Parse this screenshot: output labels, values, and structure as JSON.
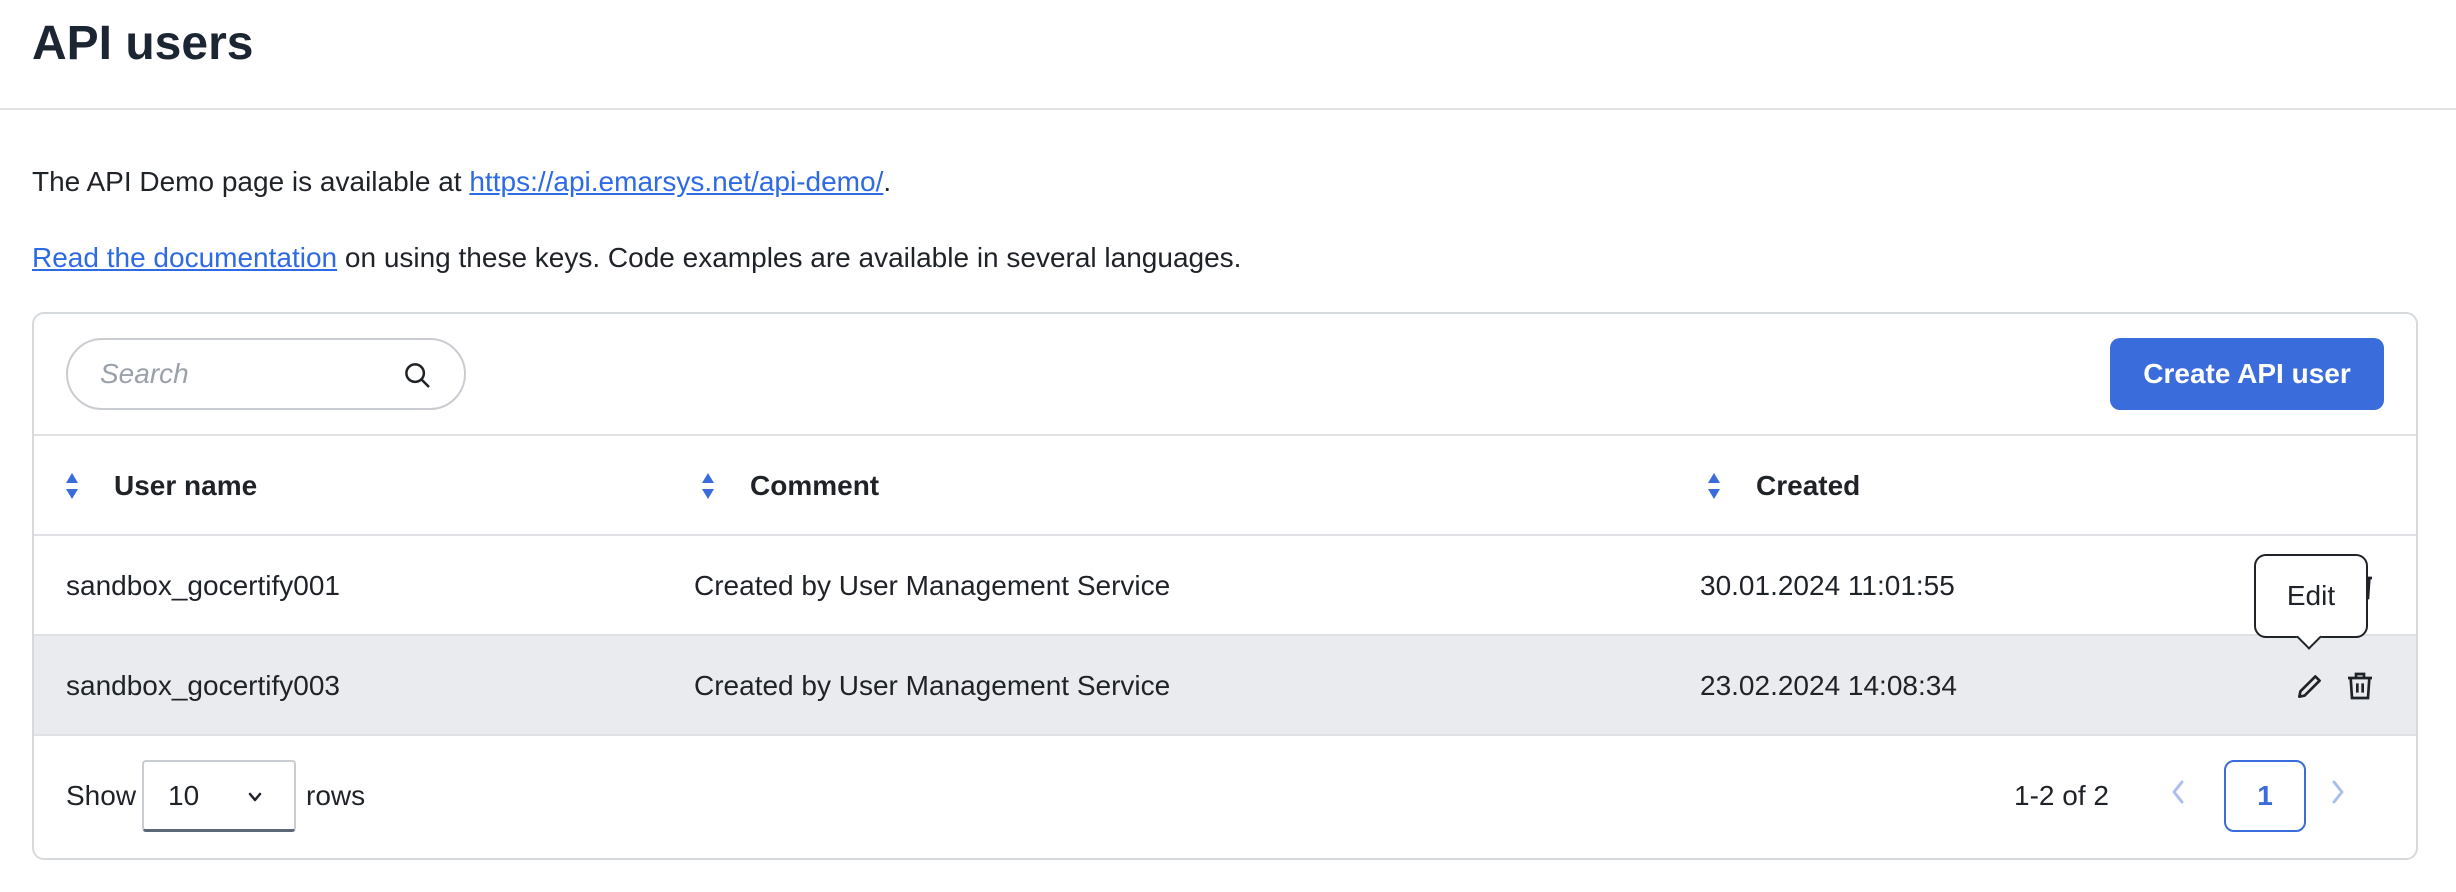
{
  "page": {
    "title": "API users"
  },
  "info": {
    "line1_prefix": "The API Demo page is available at ",
    "line1_link": "https://api.emarsys.net/api-demo/",
    "line1_suffix": ".",
    "line2_link": "Read the documentation",
    "line2_suffix": " on using these keys. Code examples are available in several languages."
  },
  "toolbar": {
    "search_placeholder": "Search",
    "search_value": "",
    "create_label": "Create API user"
  },
  "table": {
    "columns": [
      "User name",
      "Comment",
      "Created"
    ],
    "rows": [
      {
        "user": "sandbox_gocertify001",
        "comment": "Created by User Management Service",
        "created": "30.01.2024 11:01:55"
      },
      {
        "user": "sandbox_gocertify003",
        "comment": "Created by User Management Service",
        "created": "23.02.2024 14:08:34"
      }
    ]
  },
  "tooltip": {
    "text": "Edit"
  },
  "footer": {
    "show_label": "Show",
    "rows_per_page": "10",
    "rows_label": "rows",
    "range_text": "1-2 of 2",
    "current_page": "1"
  },
  "colors": {
    "accent": "#3b6cdb",
    "link": "#2d6ae3",
    "row_hover": "#e9ebee",
    "border": "#d7dadd"
  },
  "icons": [
    "search-icon",
    "sort-icon",
    "edit-icon",
    "trash-icon",
    "chevron-down-icon",
    "chevron-left-icon",
    "chevron-right-icon"
  ]
}
